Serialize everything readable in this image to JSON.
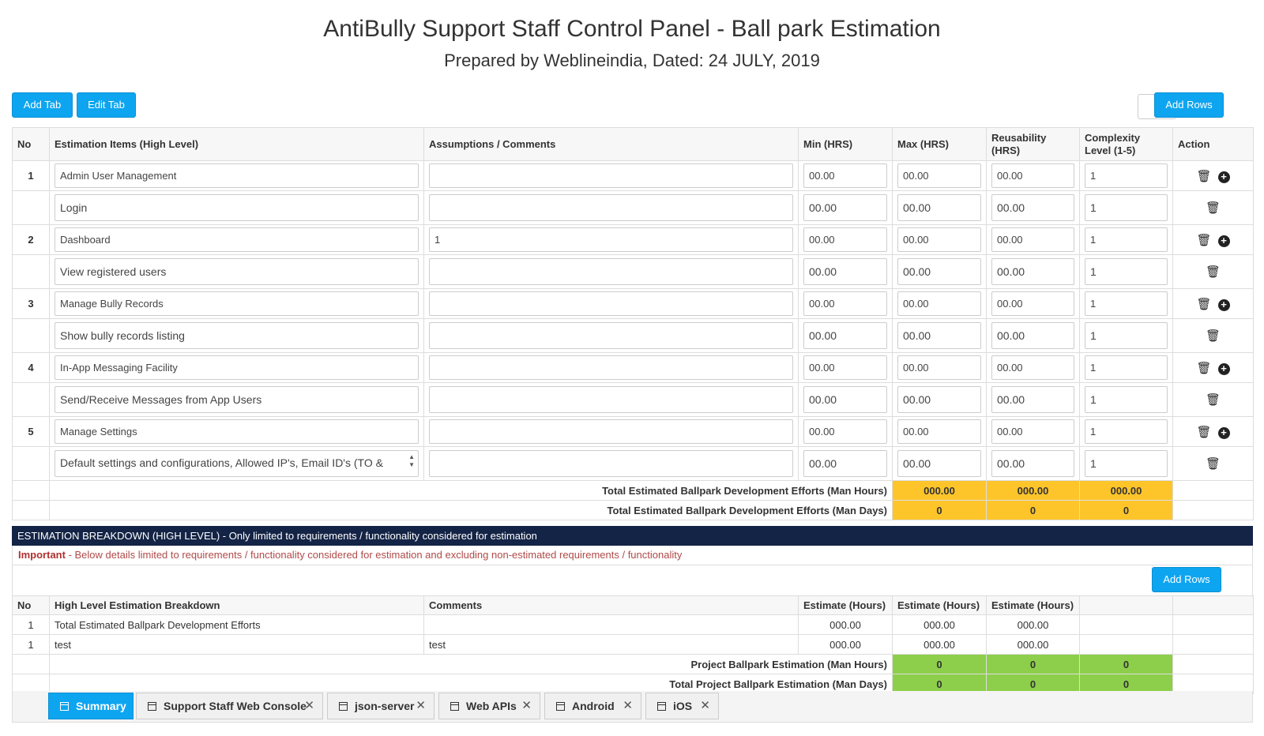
{
  "header": {
    "title": "AntiBully Support Staff Control Panel - Ball park Estimation",
    "subtitle": "Prepared by Weblineindia, Dated: 24 JULY, 2019"
  },
  "toolbar": {
    "add_tab": "Add Tab",
    "edit_tab": "Edit Tab",
    "add_rows": "Add Rows",
    "rows_count_value": ""
  },
  "main_table": {
    "headers": [
      "No",
      "Estimation Items (High Level)",
      "Assumptions / Comments",
      "Min (HRS)",
      "Max (HRS)",
      "Reusability (HRS)",
      "Complexity Level (1-5)",
      "Action"
    ],
    "rows": [
      {
        "no": "1",
        "item": "Admin User Management",
        "comment": "",
        "min": "00.00",
        "max": "00.00",
        "reuse": "00.00",
        "complexity": "1"
      },
      {
        "no": "",
        "item": "Login",
        "comment": "",
        "min": "00.00",
        "max": "00.00",
        "reuse": "00.00",
        "complexity": "1"
      },
      {
        "no": "2",
        "item": "Dashboard",
        "comment": "1",
        "min": "00.00",
        "max": "00.00",
        "reuse": "00.00",
        "complexity": "1"
      },
      {
        "no": "",
        "item": "View registered users",
        "comment": "",
        "min": "00.00",
        "max": "00.00",
        "reuse": "00.00",
        "complexity": "1"
      },
      {
        "no": "3",
        "item": "Manage Bully Records",
        "comment": "",
        "min": "00.00",
        "max": "00.00",
        "reuse": "00.00",
        "complexity": "1"
      },
      {
        "no": "",
        "item": "Show bully records listing",
        "comment": "",
        "min": "00.00",
        "max": "00.00",
        "reuse": "00.00",
        "complexity": "1"
      },
      {
        "no": "4",
        "item": "In-App Messaging Facility",
        "comment": "",
        "min": "00.00",
        "max": "00.00",
        "reuse": "00.00",
        "complexity": "1"
      },
      {
        "no": "",
        "item": "Send/Receive Messages from App Users",
        "comment": "",
        "min": "00.00",
        "max": "00.00",
        "reuse": "00.00",
        "complexity": "1"
      },
      {
        "no": "5",
        "item": "Manage Settings",
        "comment": "",
        "min": "00.00",
        "max": "00.00",
        "reuse": "00.00",
        "complexity": "1"
      },
      {
        "no": "",
        "item": "Default settings and configurations, Allowed IP's, Email ID's (TO &",
        "comment": "",
        "min": "00.00",
        "max": "00.00",
        "reuse": "00.00",
        "complexity": "1"
      }
    ],
    "total_hours_label": "Total Estimated Ballpark Development Efforts (Man Hours)",
    "total_hours": [
      "000.00",
      "000.00",
      "000.00"
    ],
    "total_days_label": "Total Estimated Ballpark Development Efforts (Man Days)",
    "total_days": [
      "0",
      "0",
      "0"
    ]
  },
  "breakdown": {
    "section_title": "ESTIMATION BREAKDOWN (HIGH LEVEL) - Only limited to requirements / functionality considered for estimation",
    "important_label": "Important",
    "important_text": " - Below details limited to requirements / functionality considered for estimation and excluding non-estimated requirements / functionality",
    "add_rows": "Add Rows",
    "headers": [
      "No",
      "High Level Estimation Breakdown",
      "Comments",
      "Estimate (Hours)",
      "Estimate (Hours)",
      "Estimate (Hours)"
    ],
    "rows": [
      {
        "no": "1",
        "item": "Total Estimated Ballpark Development Efforts",
        "comment": "",
        "e1": "000.00",
        "e2": "000.00",
        "e3": "000.00"
      },
      {
        "no": "1",
        "item": "test",
        "comment": "test",
        "e1": "000.00",
        "e2": "000.00",
        "e3": "000.00"
      }
    ],
    "project_hours_label": "Project Ballpark Estimation (Man Hours)",
    "project_hours": [
      "0",
      "0",
      "0"
    ],
    "project_days_label": "Total Project Ballpark Estimation (Man Days)",
    "project_days": [
      "0",
      "0",
      "0"
    ]
  },
  "tabs": [
    {
      "label": "Summary",
      "active": true,
      "closable": false
    },
    {
      "label": "Support Staff Web Console",
      "active": false,
      "closable": true
    },
    {
      "label": "json-server",
      "active": false,
      "closable": true
    },
    {
      "label": "Web APIs",
      "active": false,
      "closable": true
    },
    {
      "label": "Android",
      "active": false,
      "closable": true
    },
    {
      "label": "iOS",
      "active": false,
      "closable": true
    }
  ],
  "colors": {
    "primary": "#0ea5f0",
    "total_yellow": "#fdc52a",
    "total_green": "#8dcf4a",
    "section_bar": "#142446",
    "important_red": "#b04a48"
  },
  "icons": {
    "delete": "trash-icon",
    "add": "plus-circle-icon",
    "tab": "calendar-icon",
    "close": "close-icon"
  }
}
